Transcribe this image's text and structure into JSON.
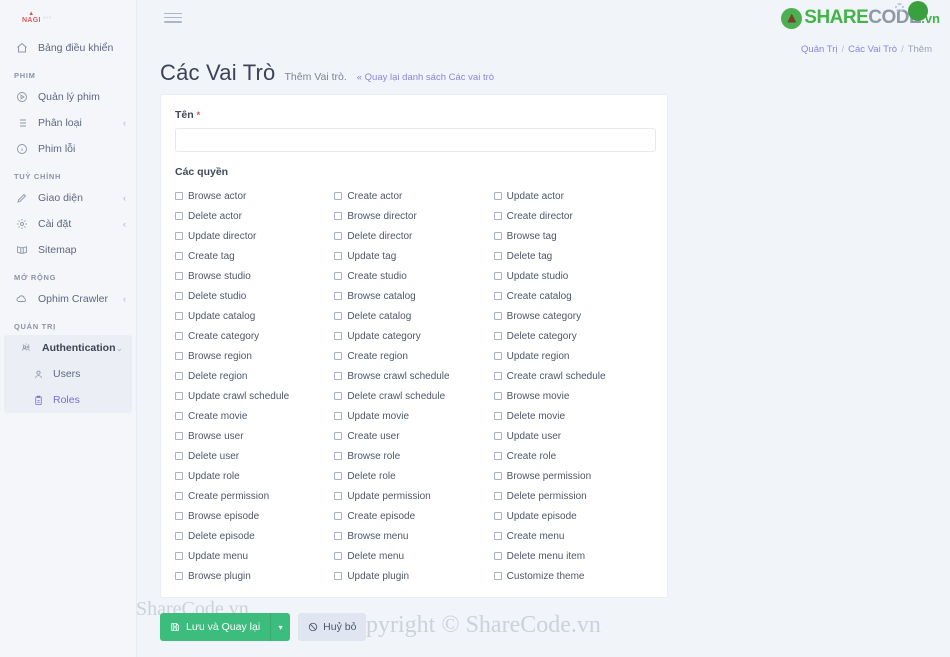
{
  "brand": {
    "logo_text": "NAGI"
  },
  "topbar": {
    "hamburger_icon": "hamburger-icon"
  },
  "site_logo": {
    "share": "SHARE",
    "code": "CODE",
    "vn": ".vn"
  },
  "breadcrumb": {
    "items": [
      "Quản Trị",
      "Các Vai Trò",
      "Thêm"
    ],
    "separator": "/"
  },
  "sidebar": {
    "dashboard": {
      "label": "Bảng điều khiển",
      "icon": "home-icon"
    },
    "sections": [
      {
        "label": "PHIM",
        "items": [
          {
            "label": "Quản lý phim",
            "icon": "film-play-icon",
            "caret": ""
          },
          {
            "label": "Phân loại",
            "icon": "list-icon",
            "caret": "‹"
          },
          {
            "label": "Phim lỗi",
            "icon": "info-circle-icon",
            "caret": ""
          }
        ]
      },
      {
        "label": "TUỲ CHỈNH",
        "items": [
          {
            "label": "Giao diện",
            "icon": "pencil-icon",
            "caret": "‹"
          },
          {
            "label": "Cài đặt",
            "icon": "gear-icon",
            "caret": "‹"
          },
          {
            "label": "Sitemap",
            "icon": "book-icon",
            "caret": ""
          }
        ]
      },
      {
        "label": "MỞ RỘNG",
        "items": [
          {
            "label": "Ophim Crawler",
            "icon": "cloud-icon",
            "caret": "‹"
          }
        ]
      }
    ],
    "admin_section": {
      "label": "QUẢN TRỊ",
      "group": {
        "label": "Authentication",
        "icon": "shield-users-icon",
        "caret": "⌄"
      },
      "children": [
        {
          "label": "Users",
          "icon": "user-icon",
          "active": false
        },
        {
          "label": "Roles",
          "icon": "badge-icon",
          "active": true
        }
      ]
    }
  },
  "page": {
    "title": "Các Vai Trò",
    "subtitle": "Thêm Vai trò.",
    "back_link": "« Quay lại danh sách Các vai trò"
  },
  "form": {
    "name_label": "Tên",
    "required_mark": "*",
    "name_value": "",
    "name_placeholder": "",
    "permissions_label": "Các quyền",
    "permission_columns": [
      [
        "Browse actor",
        "Delete actor",
        "Update director",
        "Create tag",
        "Browse studio",
        "Delete studio",
        "Update catalog",
        "Create category",
        "Browse region",
        "Delete region",
        "Update crawl schedule",
        "Create movie",
        "Browse user",
        "Delete user",
        "Update role",
        "Create permission",
        "Browse episode",
        "Delete episode",
        "Update menu",
        "Browse plugin"
      ],
      [
        "Create actor",
        "Browse director",
        "Delete director",
        "Update tag",
        "Create studio",
        "Browse catalog",
        "Delete catalog",
        "Update category",
        "Create region",
        "Browse crawl schedule",
        "Delete crawl schedule",
        "Update movie",
        "Create user",
        "Browse role",
        "Delete role",
        "Update permission",
        "Create episode",
        "Browse menu",
        "Delete menu",
        "Update plugin"
      ],
      [
        "Update actor",
        "Create director",
        "Browse tag",
        "Delete tag",
        "Update studio",
        "Create catalog",
        "Browse category",
        "Delete category",
        "Update region",
        "Create crawl schedule",
        "Browse movie",
        "Delete movie",
        "Update user",
        "Create role",
        "Browse permission",
        "Delete permission",
        "Update episode",
        "Create menu",
        "Delete menu item",
        "Customize theme"
      ]
    ]
  },
  "footer": {
    "save_label": "Lưu và Quay lại",
    "save_icon": "save-icon",
    "save_caret": "▾",
    "cancel_label": "Huỷ bỏ",
    "cancel_icon": "ban-icon"
  },
  "watermarks": {
    "top": "ShareCode.vn",
    "bottom": "Copyright © ShareCode.vn"
  },
  "colors": {
    "accent_purple": "#7b6ae0",
    "save_green": "#3cbd7d",
    "page_bg": "#f1f4f9",
    "sidebar_bg": "#f4f6fa",
    "required_red": "#d9534f"
  }
}
